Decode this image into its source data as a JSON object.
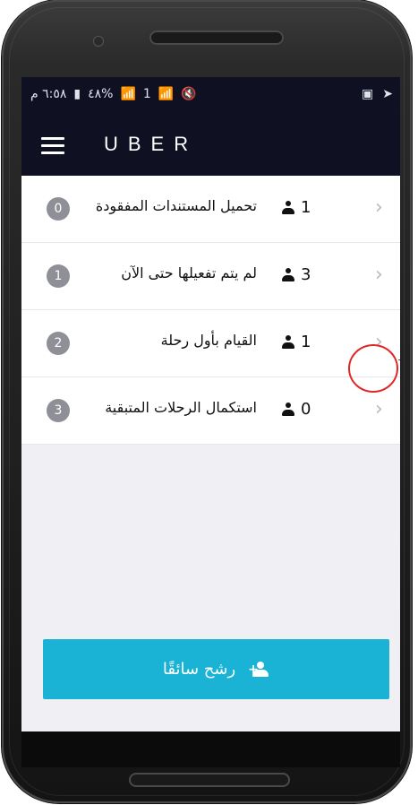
{
  "status": {
    "time": "٦:٥٨ م",
    "battery": "٤٨%",
    "sim_slot": "1"
  },
  "appbar": {
    "title": "UBER"
  },
  "rows": [
    {
      "badge": "0",
      "label": "تحميل المستندات المفقودة",
      "count": "1"
    },
    {
      "badge": "1",
      "label": "لم يتم تفعيلها حتى الآن",
      "count": "3"
    },
    {
      "badge": "2",
      "label": "القيام بأول رحلة",
      "count": "1"
    },
    {
      "badge": "3",
      "label": "استكمال الرحلات المتبقية",
      "count": "0"
    }
  ],
  "cta": {
    "label": "رشح سائقًا"
  },
  "colors": {
    "appbar": "#0f1123",
    "badge": "#8f8f97",
    "cta": "#1ab3d6",
    "highlight": "#e02727"
  },
  "icons": {
    "chevron": "chevron-right-icon",
    "person": "person-icon",
    "add_person": "add-person-icon"
  }
}
